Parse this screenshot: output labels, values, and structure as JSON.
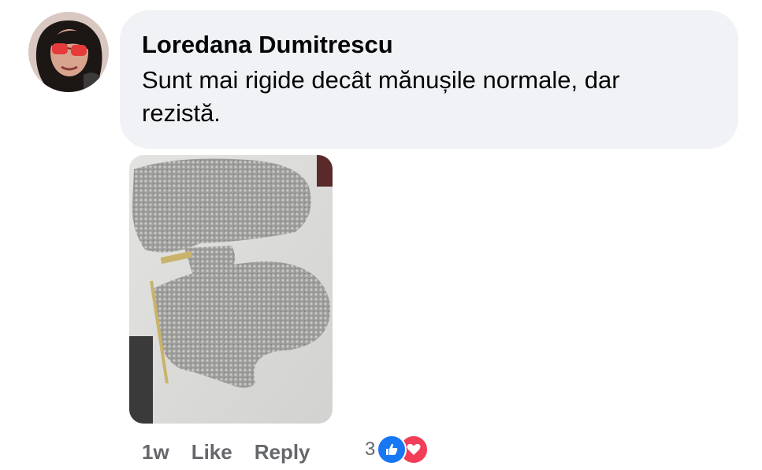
{
  "comment": {
    "author": "Loredana Dumitrescu",
    "text": "Sunt mai rigide decât mănușile normale, dar rezistă."
  },
  "actions": {
    "timestamp": "1w",
    "like_label": "Like",
    "reply_label": "Reply"
  },
  "reactions": {
    "count": "3",
    "types": [
      "like-icon",
      "love-icon"
    ]
  },
  "colors": {
    "bubble": "#f0f2f5",
    "action_text": "#65676b",
    "like": "#1877f2",
    "love": "#f33e58"
  }
}
